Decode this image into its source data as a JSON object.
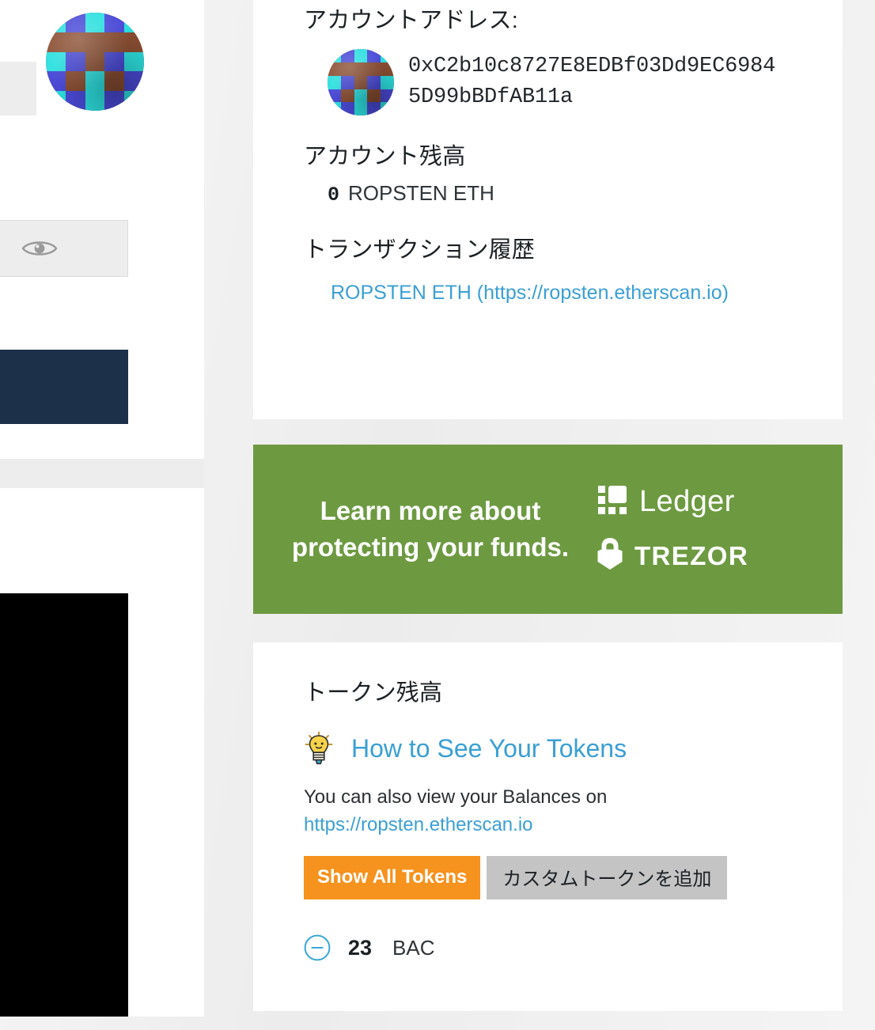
{
  "account": {
    "address_heading": "アカウントアドレス:",
    "address": "0xC2b10c8727E8EDBf03Dd9EC69845D99bBDfAB11a",
    "balance_heading": "アカウント残高",
    "balance_amount": "0",
    "balance_unit": "ROPSTEN ETH",
    "history_heading": "トランザクション履歴",
    "history_link": "ROPSTEN ETH (https://ropsten.etherscan.io)"
  },
  "promo": {
    "text": "Learn more about protecting your funds.",
    "ledger_label": "Ledger",
    "trezor_label": "TREZOR",
    "background_color": "#6d9a41"
  },
  "tokens": {
    "heading": "トークン残高",
    "how_to_link": "How to See Your Tokens",
    "also_view_text": "You can also view your Balances on",
    "etherscan_url": "https://ropsten.etherscan.io",
    "show_all_label": "Show All Tokens",
    "add_custom_label": "カスタムトークンを追加",
    "show_all_color": "#f6921e",
    "add_custom_color": "#c4c4c4",
    "list": [
      {
        "amount": "23",
        "symbol": "BAC"
      }
    ]
  },
  "sidebar": {
    "eye_icon": "eye-icon",
    "navy_panel_color": "#1c3049",
    "black_panel_color": "#000000"
  },
  "identicon": {
    "colors": {
      "brown": "#8b4f33",
      "cyan": "#2ee0e0",
      "blue": "#4b4bd8"
    },
    "pattern": [
      [
        "cyan",
        "blue",
        "cyan",
        "blue",
        "cyan"
      ],
      [
        "brown",
        "brown",
        "brown",
        "brown",
        "brown"
      ],
      [
        "cyan",
        "blue",
        "brown",
        "blue",
        "cyan"
      ],
      [
        "blue",
        "brown",
        "cyan",
        "brown",
        "blue"
      ],
      [
        "cyan",
        "blue",
        "cyan",
        "blue",
        "cyan"
      ]
    ]
  }
}
